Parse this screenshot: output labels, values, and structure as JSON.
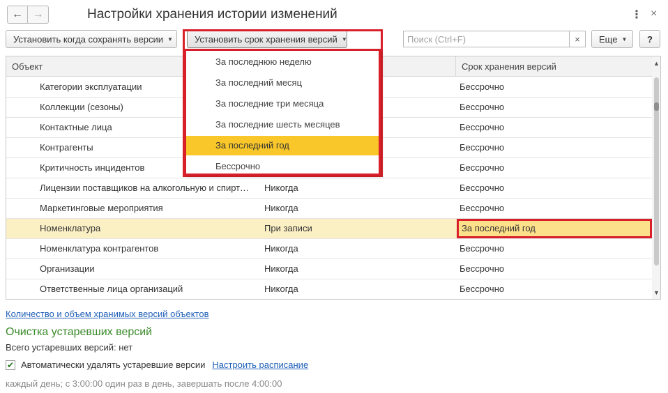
{
  "window": {
    "title": "Настройки хранения истории изменений",
    "back_icon": "←",
    "forward_icon": "→",
    "more_icon": "⋮",
    "close_icon": "×"
  },
  "toolbar": {
    "set_when_label": "Установить когда сохранять версии",
    "set_period_label": "Установить срок хранения версий",
    "caret": "▼",
    "search_placeholder": "Поиск (Ctrl+F)",
    "search_value": "",
    "search_clear": "×",
    "more_label": "Еще",
    "help_label": "?"
  },
  "table": {
    "columns": {
      "object": "Объект",
      "when": "",
      "period": "Срок хранения версий"
    },
    "rows": [
      {
        "object": "Категории эксплуатации",
        "when": "",
        "period": "Бессрочно"
      },
      {
        "object": "Коллекции (сезоны)",
        "when": "",
        "period": "Бессрочно"
      },
      {
        "object": "Контактные лица",
        "when": "",
        "period": "Бессрочно"
      },
      {
        "object": "Контрагенты",
        "when": "",
        "period": "Бессрочно"
      },
      {
        "object": "Критичность инцидентов",
        "when": "",
        "period": "Бессрочно"
      },
      {
        "object": "Лицензии поставщиков на алкогольную и спиртосодержащую продукцию",
        "when": "Никогда",
        "period": "Бессрочно"
      },
      {
        "object": "Маркетинговые мероприятия",
        "when": "Никогда",
        "period": "Бессрочно"
      },
      {
        "object": "Номенклатура",
        "when": "При записи",
        "period": "За последний год",
        "selected": true
      },
      {
        "object": "Номенклатура контрагентов",
        "when": "Никогда",
        "period": "Бессрочно"
      },
      {
        "object": "Организации",
        "when": "Никогда",
        "period": "Бессрочно"
      },
      {
        "object": "Ответственные лица организаций",
        "when": "Никогда",
        "period": "Бессрочно"
      }
    ],
    "scroll_up": "▲",
    "scroll_down": "▼"
  },
  "dropdown": {
    "items": [
      "За последнюю неделю",
      "За последний месяц",
      "За последние три месяца",
      "За последние шесть месяцев",
      "За последний год",
      "Бессрочно"
    ],
    "active_index": 4
  },
  "footer": {
    "count_link": "Количество и объем хранимых версий объектов",
    "section_title": "Очистка устаревших версий",
    "total_text": "Всего устаревших версий: нет",
    "auto_delete_label": "Автоматически удалять устаревшие версии",
    "auto_delete_checked": true,
    "check_mark": "✔",
    "schedule_link": "Настроить расписание",
    "schedule_text": "каждый день; с 3:00:00 один раз в день, завершать после 4:00:00"
  }
}
